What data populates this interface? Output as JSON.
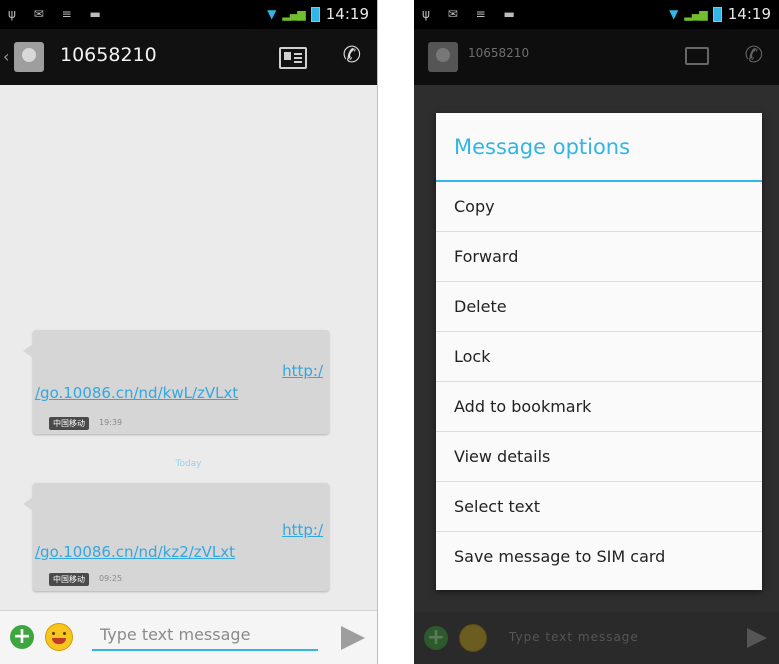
{
  "status_bar": {
    "time": "14:19",
    "icons": [
      "usb-icon",
      "alert-icon",
      "sd-icon",
      "wifi-icon",
      "signal-icon",
      "battery-icon"
    ]
  },
  "conversation": {
    "contact_name": "10658210",
    "date_separators": [
      "",
      "Today"
    ],
    "messages": [
      {
        "link_tail": "http:/",
        "link_main": "/go.10086.cn/nd/kwL/zVLxt",
        "sender": "中国移动",
        "time": "19:39"
      },
      {
        "link_tail": "http:/",
        "link_main": "/go.10086.cn/nd/kz2/zVLxt",
        "sender": "中国移动",
        "time": "09:25"
      }
    ]
  },
  "compose": {
    "placeholder": "Type text message"
  },
  "dialog": {
    "title": "Message options",
    "items": [
      "Copy",
      "Forward",
      "Delete",
      "Lock",
      "Add to bookmark",
      "View details",
      "Select text",
      "Save message to SIM card"
    ]
  },
  "colors": {
    "accent": "#33b5e5",
    "link": "#33a7e0",
    "bubble": "#d6d6d6"
  }
}
